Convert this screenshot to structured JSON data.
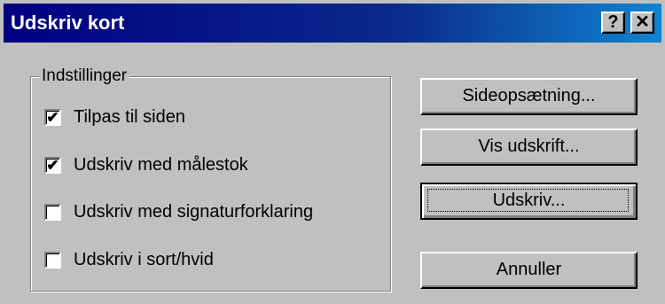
{
  "window": {
    "title": "Udskriv kort",
    "help_label": "?",
    "close_label": "✕"
  },
  "settings": {
    "group_label": "Indstillinger",
    "options": [
      {
        "label": "Tilpas til siden",
        "checked": true,
        "mark": "✔"
      },
      {
        "label": "Udskriv med målestok",
        "checked": true,
        "mark": "✔"
      },
      {
        "label": "Udskriv med signaturforklaring",
        "checked": false,
        "mark": ""
      },
      {
        "label": "Udskriv i sort/hvid",
        "checked": false,
        "mark": ""
      }
    ]
  },
  "buttons": {
    "page_setup": "Sideopsætning...",
    "preview": "Vis udskrift...",
    "print": "Udskriv...",
    "cancel": "Annuller"
  },
  "colors": {
    "titlebar_start": "#000080",
    "titlebar_end": "#1084d0",
    "face": "#c0c0c0"
  }
}
